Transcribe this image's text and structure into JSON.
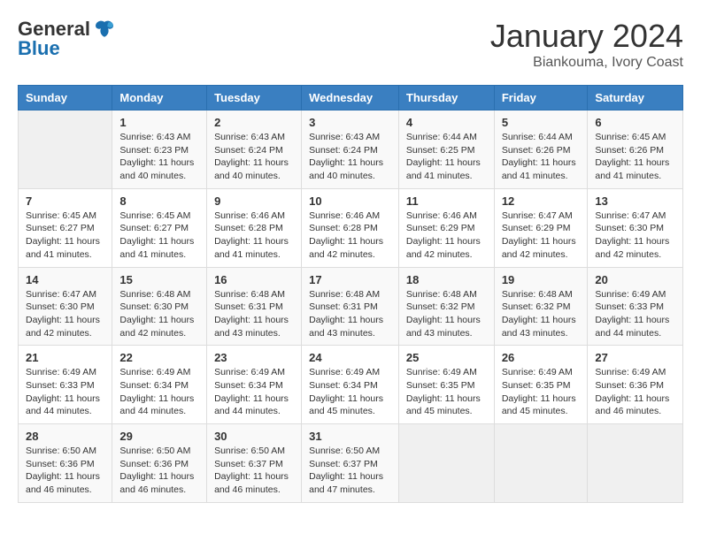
{
  "logo": {
    "general": "General",
    "blue": "Blue"
  },
  "title": "January 2024",
  "location": "Biankouma, Ivory Coast",
  "headers": [
    "Sunday",
    "Monday",
    "Tuesday",
    "Wednesday",
    "Thursday",
    "Friday",
    "Saturday"
  ],
  "weeks": [
    [
      {
        "day": "",
        "info": ""
      },
      {
        "day": "1",
        "info": "Sunrise: 6:43 AM\nSunset: 6:23 PM\nDaylight: 11 hours\nand 40 minutes."
      },
      {
        "day": "2",
        "info": "Sunrise: 6:43 AM\nSunset: 6:24 PM\nDaylight: 11 hours\nand 40 minutes."
      },
      {
        "day": "3",
        "info": "Sunrise: 6:43 AM\nSunset: 6:24 PM\nDaylight: 11 hours\nand 40 minutes."
      },
      {
        "day": "4",
        "info": "Sunrise: 6:44 AM\nSunset: 6:25 PM\nDaylight: 11 hours\nand 41 minutes."
      },
      {
        "day": "5",
        "info": "Sunrise: 6:44 AM\nSunset: 6:26 PM\nDaylight: 11 hours\nand 41 minutes."
      },
      {
        "day": "6",
        "info": "Sunrise: 6:45 AM\nSunset: 6:26 PM\nDaylight: 11 hours\nand 41 minutes."
      }
    ],
    [
      {
        "day": "7",
        "info": "Sunrise: 6:45 AM\nSunset: 6:27 PM\nDaylight: 11 hours\nand 41 minutes."
      },
      {
        "day": "8",
        "info": "Sunrise: 6:45 AM\nSunset: 6:27 PM\nDaylight: 11 hours\nand 41 minutes."
      },
      {
        "day": "9",
        "info": "Sunrise: 6:46 AM\nSunset: 6:28 PM\nDaylight: 11 hours\nand 41 minutes."
      },
      {
        "day": "10",
        "info": "Sunrise: 6:46 AM\nSunset: 6:28 PM\nDaylight: 11 hours\nand 42 minutes."
      },
      {
        "day": "11",
        "info": "Sunrise: 6:46 AM\nSunset: 6:29 PM\nDaylight: 11 hours\nand 42 minutes."
      },
      {
        "day": "12",
        "info": "Sunrise: 6:47 AM\nSunset: 6:29 PM\nDaylight: 11 hours\nand 42 minutes."
      },
      {
        "day": "13",
        "info": "Sunrise: 6:47 AM\nSunset: 6:30 PM\nDaylight: 11 hours\nand 42 minutes."
      }
    ],
    [
      {
        "day": "14",
        "info": "Sunrise: 6:47 AM\nSunset: 6:30 PM\nDaylight: 11 hours\nand 42 minutes."
      },
      {
        "day": "15",
        "info": "Sunrise: 6:48 AM\nSunset: 6:30 PM\nDaylight: 11 hours\nand 42 minutes."
      },
      {
        "day": "16",
        "info": "Sunrise: 6:48 AM\nSunset: 6:31 PM\nDaylight: 11 hours\nand 43 minutes."
      },
      {
        "day": "17",
        "info": "Sunrise: 6:48 AM\nSunset: 6:31 PM\nDaylight: 11 hours\nand 43 minutes."
      },
      {
        "day": "18",
        "info": "Sunrise: 6:48 AM\nSunset: 6:32 PM\nDaylight: 11 hours\nand 43 minutes."
      },
      {
        "day": "19",
        "info": "Sunrise: 6:48 AM\nSunset: 6:32 PM\nDaylight: 11 hours\nand 43 minutes."
      },
      {
        "day": "20",
        "info": "Sunrise: 6:49 AM\nSunset: 6:33 PM\nDaylight: 11 hours\nand 44 minutes."
      }
    ],
    [
      {
        "day": "21",
        "info": "Sunrise: 6:49 AM\nSunset: 6:33 PM\nDaylight: 11 hours\nand 44 minutes."
      },
      {
        "day": "22",
        "info": "Sunrise: 6:49 AM\nSunset: 6:34 PM\nDaylight: 11 hours\nand 44 minutes."
      },
      {
        "day": "23",
        "info": "Sunrise: 6:49 AM\nSunset: 6:34 PM\nDaylight: 11 hours\nand 44 minutes."
      },
      {
        "day": "24",
        "info": "Sunrise: 6:49 AM\nSunset: 6:34 PM\nDaylight: 11 hours\nand 45 minutes."
      },
      {
        "day": "25",
        "info": "Sunrise: 6:49 AM\nSunset: 6:35 PM\nDaylight: 11 hours\nand 45 minutes."
      },
      {
        "day": "26",
        "info": "Sunrise: 6:49 AM\nSunset: 6:35 PM\nDaylight: 11 hours\nand 45 minutes."
      },
      {
        "day": "27",
        "info": "Sunrise: 6:49 AM\nSunset: 6:36 PM\nDaylight: 11 hours\nand 46 minutes."
      }
    ],
    [
      {
        "day": "28",
        "info": "Sunrise: 6:50 AM\nSunset: 6:36 PM\nDaylight: 11 hours\nand 46 minutes."
      },
      {
        "day": "29",
        "info": "Sunrise: 6:50 AM\nSunset: 6:36 PM\nDaylight: 11 hours\nand 46 minutes."
      },
      {
        "day": "30",
        "info": "Sunrise: 6:50 AM\nSunset: 6:37 PM\nDaylight: 11 hours\nand 46 minutes."
      },
      {
        "day": "31",
        "info": "Sunrise: 6:50 AM\nSunset: 6:37 PM\nDaylight: 11 hours\nand 47 minutes."
      },
      {
        "day": "",
        "info": ""
      },
      {
        "day": "",
        "info": ""
      },
      {
        "day": "",
        "info": ""
      }
    ]
  ]
}
